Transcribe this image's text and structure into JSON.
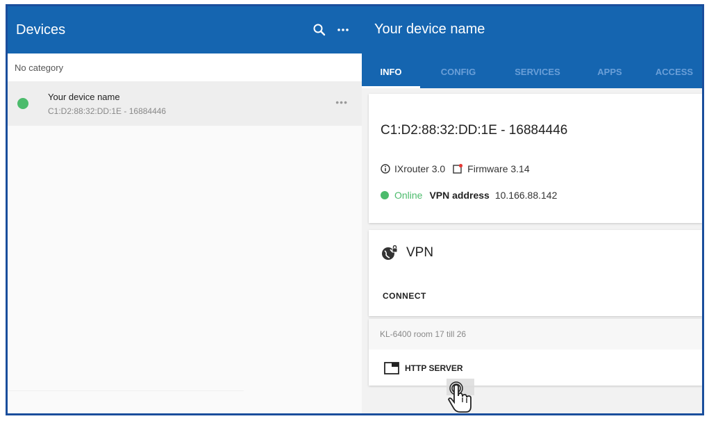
{
  "left": {
    "title": "Devices",
    "category": "No category",
    "device": {
      "name": "Your device name",
      "id": "C1:D2:88:32:DD:1E - 16884446",
      "status_color": "#4cbb6c"
    },
    "icons": [
      "search-icon",
      "more-icon"
    ]
  },
  "right": {
    "title": "Your device name",
    "tabs": [
      {
        "label": "INFO",
        "active": true
      },
      {
        "label": "CONFIG",
        "active": false
      },
      {
        "label": "SERVICES",
        "active": false
      },
      {
        "label": "APPS",
        "active": false
      },
      {
        "label": "ACCESS",
        "active": false
      }
    ],
    "info": {
      "device_id": "C1:D2:88:32:DD:1E - 16884446",
      "model": "IXrouter 3.0",
      "firmware": "Firmware 3.14",
      "status": "Online",
      "vpn_address_label": "VPN address",
      "vpn_address": "10.166.88.142"
    },
    "vpn": {
      "title": "VPN",
      "connect_label": "CONNECT"
    },
    "service": {
      "name": "KL-6400 room 17 till 26",
      "button_label": "HTTP SERVER"
    }
  },
  "colors": {
    "header": "#1565b0",
    "online": "#4cbb6c",
    "frame": "#1a4e9c"
  }
}
